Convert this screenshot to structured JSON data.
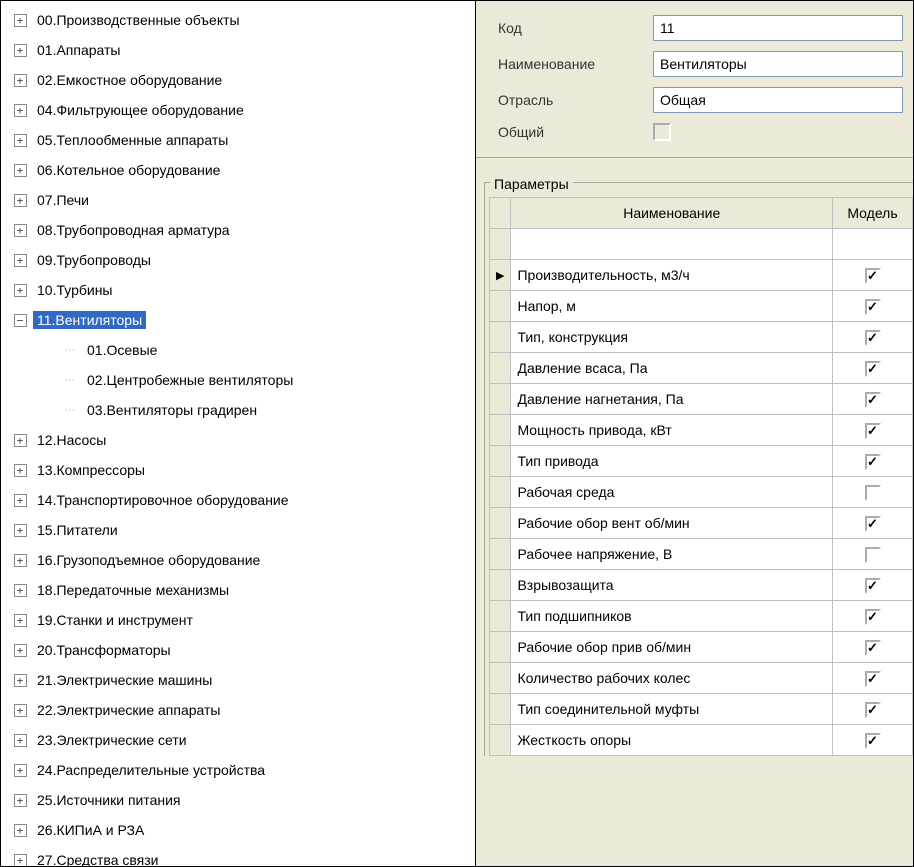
{
  "tree": [
    {
      "label": "00.Производственные объекты",
      "icon": "+"
    },
    {
      "label": "01.Аппараты",
      "icon": "+"
    },
    {
      "label": "02.Емкостное оборудование",
      "icon": "+"
    },
    {
      "label": "04.Фильтрующее  оборудование",
      "icon": "+"
    },
    {
      "label": "05.Теплообменные аппараты",
      "icon": "+"
    },
    {
      "label": "06.Котельное оборудование",
      "icon": "+"
    },
    {
      "label": "07.Печи",
      "icon": "+"
    },
    {
      "label": "08.Трубопроводная арматура",
      "icon": "+"
    },
    {
      "label": "09.Трубопроводы",
      "icon": "+"
    },
    {
      "label": "10.Турбины",
      "icon": "+"
    },
    {
      "label": "11.Вентиляторы",
      "icon": "−",
      "selected": true,
      "children": [
        {
          "label": "01.Осевые"
        },
        {
          "label": "02.Центробежные вентиляторы"
        },
        {
          "label": "03.Вентиляторы градирен"
        }
      ]
    },
    {
      "label": "12.Насосы",
      "icon": "+"
    },
    {
      "label": "13.Компрессоры",
      "icon": "+"
    },
    {
      "label": "14.Транспортировочное оборудование",
      "icon": "+"
    },
    {
      "label": "15.Питатели",
      "icon": "+"
    },
    {
      "label": "16.Грузоподъемное оборудование",
      "icon": "+"
    },
    {
      "label": "18.Передаточные механизмы",
      "icon": "+"
    },
    {
      "label": "19.Станки и инструмент",
      "icon": "+"
    },
    {
      "label": "20.Трансформаторы",
      "icon": "+"
    },
    {
      "label": "21.Электрические машины",
      "icon": "+"
    },
    {
      "label": "22.Электрические аппараты",
      "icon": "+"
    },
    {
      "label": "23.Электрические сети",
      "icon": "+"
    },
    {
      "label": "24.Распределительные устройства",
      "icon": "+"
    },
    {
      "label": "25.Источники питания",
      "icon": "+"
    },
    {
      "label": "26.КИПиА и РЗА",
      "icon": "+"
    },
    {
      "label": "27.Средства связи",
      "icon": "+"
    }
  ],
  "form": {
    "code_label": "Код",
    "code_value": "11",
    "name_label": "Наименование",
    "name_value": "Вентиляторы",
    "branch_label": "Отрасль",
    "branch_value": "Общая",
    "common_label": "Общий",
    "common_checked": false
  },
  "params": {
    "group_title": "Параметры",
    "col_name": "Наименование",
    "col_model": "Модель",
    "rows": [
      {
        "name": "Производительность, м3/ч",
        "model": true,
        "current": true
      },
      {
        "name": "Напор, м",
        "model": true
      },
      {
        "name": "Тип, конструкция",
        "model": true
      },
      {
        "name": "Давление всаса, Па",
        "model": true
      },
      {
        "name": "Давление нагнетания, Па",
        "model": true
      },
      {
        "name": "Мощность привода, кВт",
        "model": true
      },
      {
        "name": "Тип привода",
        "model": true
      },
      {
        "name": "Рабочая среда",
        "model": false
      },
      {
        "name": "Рабочие обор вент об/мин",
        "model": true
      },
      {
        "name": "Рабочее напряжение, В",
        "model": false
      },
      {
        "name": "Взрывозащита",
        "model": true
      },
      {
        "name": "Тип подшипников",
        "model": true
      },
      {
        "name": "Рабочие обор прив об/мин",
        "model": true
      },
      {
        "name": "Количество рабочих колес",
        "model": true
      },
      {
        "name": "Тип соединительной муфты",
        "model": true
      },
      {
        "name": "Жесткость опоры",
        "model": true
      }
    ]
  }
}
